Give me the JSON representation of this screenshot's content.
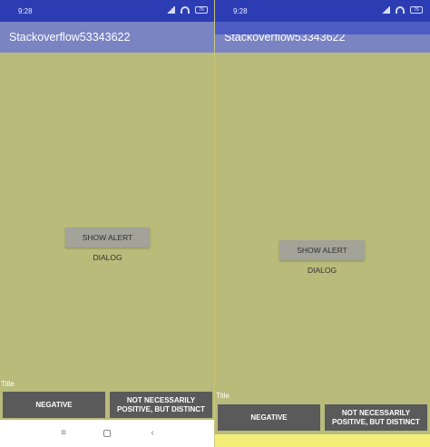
{
  "left": {
    "status_time": "9:28",
    "battery": "76",
    "app_title": "Stackoverflow53343622",
    "show_alert_label": "SHOW ALERT DIALOG",
    "dialog_title": "Title",
    "negative_label": "NEGATIVE",
    "positive_label": "NOT NECESSARILY POSITIVE, BUT DISTINCT"
  },
  "right": {
    "status_time": "9:28",
    "battery": "76",
    "app_title": "Stackoverflow53343622",
    "show_alert_label": "SHOW ALERT DIALOG",
    "dialog_title": "Title",
    "negative_label": "NEGATIVE",
    "positive_label": "NOT NECESSARILY POSITIVE, BUT DISTINCT"
  },
  "nav_icons": [
    "menu-icon",
    "home-icon",
    "back-icon"
  ],
  "colors": {
    "status_bar": "#2c3db3",
    "app_bar_dimmed": "#7a84c2",
    "content_dimmed": "#b8bb7a",
    "dialog_button": "#5a5a5a",
    "bottom_strip": "#f3ee7a"
  }
}
